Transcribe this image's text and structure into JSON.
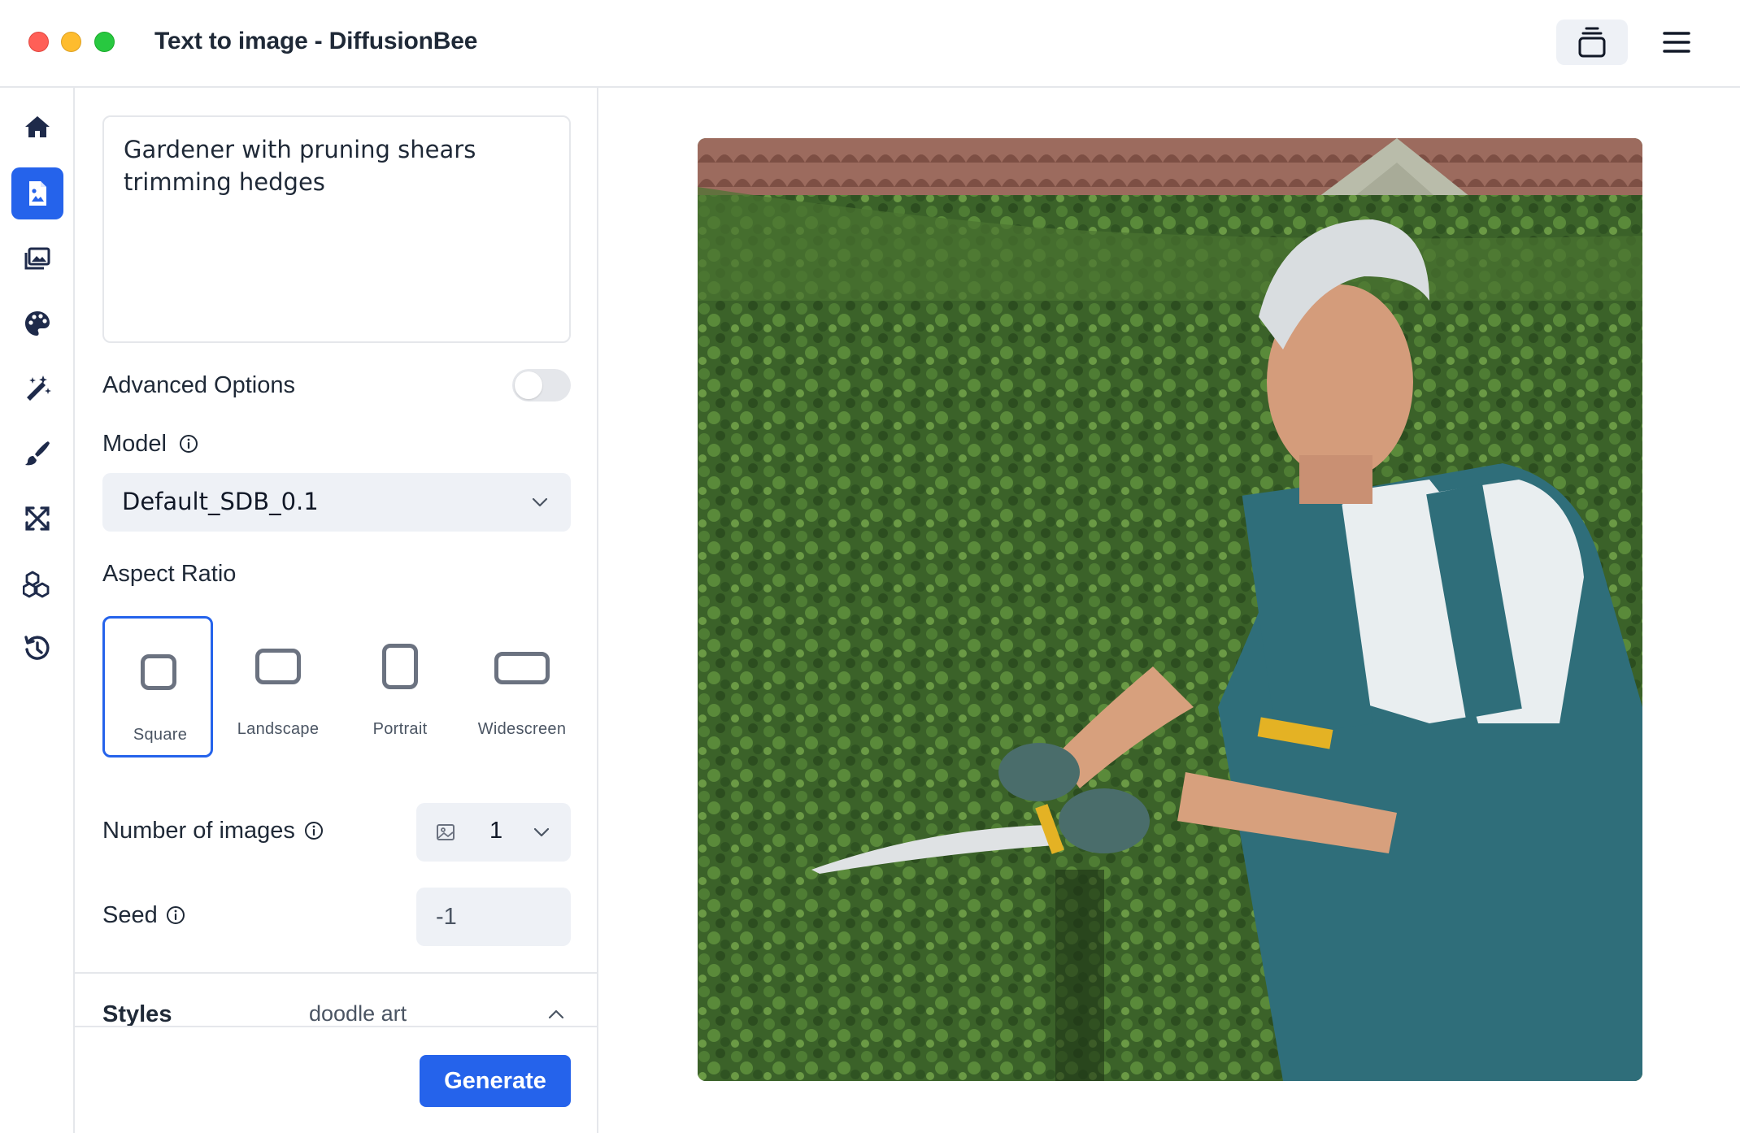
{
  "window": {
    "title": "Text to image - DiffusionBee"
  },
  "titlebar": {
    "stack_icon": "stack-icon",
    "menu_icon": "hamburger-menu-icon"
  },
  "rail": {
    "items": [
      {
        "icon": "home-icon",
        "active": false
      },
      {
        "icon": "text-to-image-icon",
        "active": true
      },
      {
        "icon": "image-to-image-icon",
        "active": false
      },
      {
        "icon": "palette-icon",
        "active": false
      },
      {
        "icon": "magic-wand-icon",
        "active": false
      },
      {
        "icon": "brush-icon",
        "active": false
      },
      {
        "icon": "upscale-icon",
        "active": false
      },
      {
        "icon": "models-icon",
        "active": false
      },
      {
        "icon": "history-icon",
        "active": false
      }
    ]
  },
  "panel": {
    "prompt": "Gardener with pruning shears trimming hedges",
    "advanced_label": "Advanced Options",
    "advanced_enabled": false,
    "model_label": "Model",
    "model_value": "Default_SDB_0.1",
    "aspect_label": "Aspect Ratio",
    "aspect_options": [
      {
        "label": "Square",
        "selected": true
      },
      {
        "label": "Landscape",
        "selected": false
      },
      {
        "label": "Portrait",
        "selected": false
      },
      {
        "label": "Widescreen",
        "selected": false
      }
    ],
    "num_images_label": "Number of images",
    "num_images_value": "1",
    "seed_label": "Seed",
    "seed_value": "-1",
    "styles_label": "Styles",
    "styles_value": "doodle art",
    "generate_label": "Generate"
  },
  "colors": {
    "accent": "#2563eb",
    "border": "#e5e7eb",
    "field_bg": "#eef1f6"
  }
}
